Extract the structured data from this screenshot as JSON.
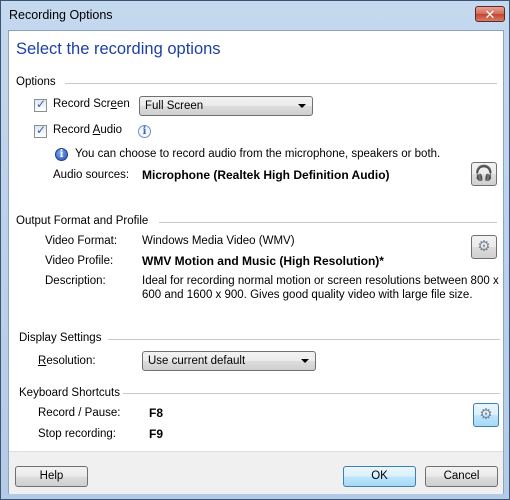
{
  "window": {
    "title": "Recording Options",
    "close_label": "✕"
  },
  "heading": "Select the recording options",
  "options": {
    "section_label": "Options",
    "record_screen": {
      "label_pre": "Record Scr",
      "label_accel": "e",
      "label_post": "en",
      "checked": true,
      "dropdown_value": "Full Screen"
    },
    "record_audio": {
      "label_pre": "Record ",
      "label_accel": "A",
      "label_post": "udio",
      "checked": true
    },
    "info_icon": "i",
    "audio_hint": "You can choose to record audio from the microphone, speakers or both.",
    "audio_sources_label": "Audio sources:",
    "audio_sources_value": "Microphone (Realtek High Definition Audio)",
    "audio_button_icon": "headset-icon"
  },
  "output": {
    "section_label": "Output Format and Profile",
    "video_format_label": "Video Format:",
    "video_format_value": "Windows Media Video (WMV)",
    "video_profile_label": "Video Profile:",
    "video_profile_value": "WMV Motion and Music (High Resolution)*",
    "description_label": "Description:",
    "description_line1": "Ideal for recording normal motion or screen resolutions between 800 x",
    "description_line2": "600 and 1600 x 900.  Gives good quality video with large file size.",
    "settings_button_icon": "gear-icon"
  },
  "display": {
    "section_label": "Display Settings",
    "resolution_label_accel": "R",
    "resolution_label_rest": "esolution:",
    "resolution_value": "Use current default"
  },
  "shortcuts": {
    "section_label": "Keyboard Shortcuts",
    "record_pause_label": "Record / Pause:",
    "record_pause_value": "F8",
    "stop_label": "Stop recording:",
    "stop_value": "F9",
    "settings_button_icon": "gear-icon"
  },
  "footer": {
    "help_label": "Help",
    "ok_label": "OK",
    "cancel_label": "Cancel"
  }
}
